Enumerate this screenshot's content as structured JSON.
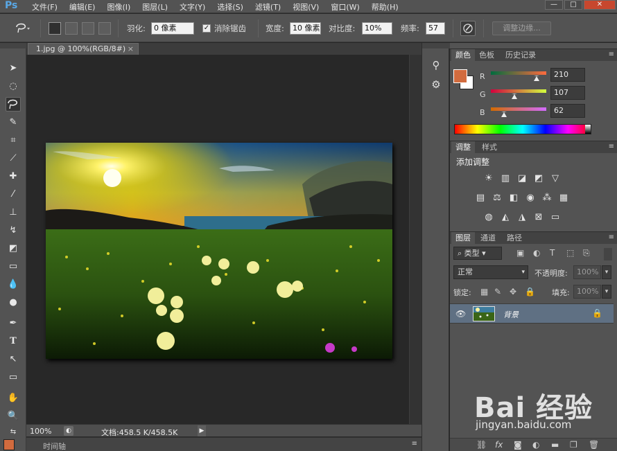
{
  "app": {
    "logo": "Ps"
  },
  "menu": [
    "文件(F)",
    "编辑(E)",
    "图像(I)",
    "图层(L)",
    "文字(Y)",
    "选择(S)",
    "滤镜(T)",
    "视图(V)",
    "窗口(W)",
    "帮助(H)"
  ],
  "window_controls": [
    "—",
    "□",
    "✕"
  ],
  "options": {
    "feather_label": "羽化:",
    "feather_value": "0 像素",
    "antialias_label": "消除锯齿",
    "antialias_checked": true,
    "width_label": "宽度:",
    "width_value": "10 像素",
    "contrast_label": "对比度:",
    "contrast_value": "10%",
    "frequency_label": "频率:",
    "frequency_value": "57",
    "refine_edge_label": "调整边缘..."
  },
  "document": {
    "tab_title": "1.jpg @ 100%(RGB/8#)",
    "tab_close": "×",
    "zoom": "100%",
    "doc_info": "文档:458.5 K/458.5K",
    "timeline_label": "时间轴"
  },
  "color_panel": {
    "tabs": [
      "颜色",
      "色板",
      "历史记录"
    ],
    "active_tab": "颜色",
    "foreground": "#d26b3e",
    "background": "#ffffff",
    "channels": [
      {
        "name": "R",
        "value": "210",
        "fraction": 0.82
      },
      {
        "name": "G",
        "value": "107",
        "fraction": 0.42
      },
      {
        "name": "B",
        "value": "62",
        "fraction": 0.24
      }
    ]
  },
  "adjust_panel": {
    "tabs": [
      "调整",
      "样式"
    ],
    "active_tab": "调整",
    "title": "添加调整"
  },
  "layers_panel": {
    "tabs": [
      "图层",
      "通道",
      "路径"
    ],
    "active_tab": "图层",
    "filter_label": "类型",
    "blend_mode": "正常",
    "opacity_label": "不透明度:",
    "opacity_value": "100%",
    "lock_label": "锁定:",
    "fill_label": "填充:",
    "fill_value": "100%",
    "layers": [
      {
        "name": "背景",
        "visible": true,
        "locked": true
      }
    ]
  },
  "watermark": {
    "main": "Bai 经验",
    "sub": "jingyan.baidu.com"
  }
}
